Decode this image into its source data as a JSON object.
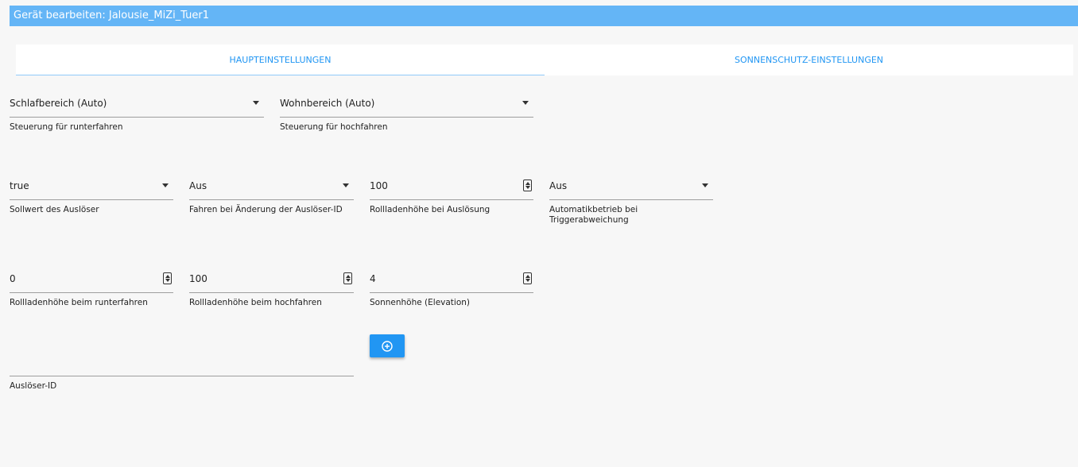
{
  "window": {
    "title": "Gerät bearbeiten: Jalousie_MiZi_Tuer1"
  },
  "tabs": [
    {
      "label": "HAUPTEINSTELLUNGEN"
    },
    {
      "label": "SONNENSCHUTZ-EINSTELLUNGEN"
    }
  ],
  "form": {
    "steuerung_runter": {
      "value": "Schlafbereich (Auto)",
      "label": "Steuerung für runterfahren"
    },
    "steuerung_hoch": {
      "value": "Wohnbereich (Auto)",
      "label": "Steuerung für hochfahren"
    },
    "sollwert": {
      "value": "true",
      "label": "Sollwert des Auslöser"
    },
    "fahren_aenderung": {
      "value": "Aus",
      "label": "Fahren bei Änderung der Auslöser-ID"
    },
    "hoehe_ausloesung": {
      "value": "100",
      "label": "Rollladenhöhe bei Auslösung"
    },
    "automatik": {
      "value": "Aus",
      "label": "Automatikbetrieb bei Triggerabweichung"
    },
    "hoehe_runter": {
      "value": "0",
      "label": "Rollladenhöhe beim runterfahren"
    },
    "hoehe_hoch": {
      "value": "100",
      "label": "Rollladenhöhe beim hochfahren"
    },
    "elevation": {
      "value": "4",
      "label": "Sonnenhöhe (Elevation)"
    },
    "ausloeser_id": {
      "value": "",
      "label": "Auslöser-ID"
    }
  },
  "icons": {
    "add": "add-circle-icon",
    "dropdown": "dropdown-caret-icon",
    "spinner": "number-spinner-icon"
  },
  "colors": {
    "titlebar": "#64b5f6",
    "accent": "#2196f3"
  }
}
